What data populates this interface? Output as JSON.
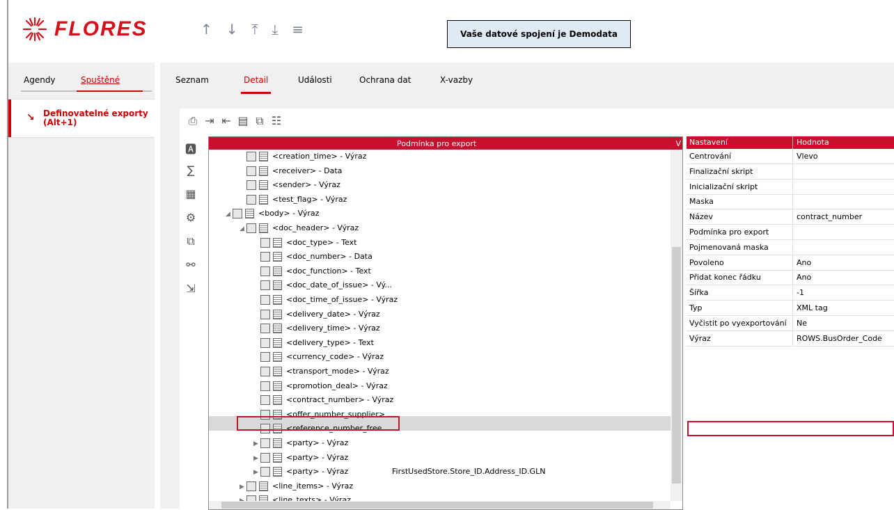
{
  "header": {
    "brand": "FLORES",
    "connection": "Vaše datové spojení je Demodata",
    "arrows": [
      "↑",
      "↓",
      "⤒",
      "⤓",
      "≡"
    ]
  },
  "sidebar": {
    "tabs": [
      "Agendy",
      "Spuštěné"
    ],
    "item": "Definovatelné exporty (Alt+1)"
  },
  "main": {
    "tabs": [
      "Seznam",
      "Detail",
      "Události",
      "Ochrana dat",
      "X-vazby"
    ]
  },
  "tree": {
    "header": "Podmínka pro export",
    "header_right": "V",
    "nodes": [
      {
        "indent": 2,
        "text": "<creation_time> - Výraz",
        "icon": "grid"
      },
      {
        "indent": 2,
        "text": "<receiver> - Data",
        "icon": "lines"
      },
      {
        "indent": 2,
        "text": "<sender> - Výraz",
        "icon": "grid"
      },
      {
        "indent": 2,
        "text": "<test_flag> - Výraz",
        "icon": "grid"
      },
      {
        "indent": 1,
        "text": "<body> - Výraz",
        "icon": "grid",
        "exp": "◢"
      },
      {
        "indent": 2,
        "text": "<doc_header> - Výraz",
        "icon": "grid",
        "exp": "◢"
      },
      {
        "indent": 3,
        "text": "<doc_type> - Text",
        "icon": "text"
      },
      {
        "indent": 3,
        "text": "<doc_number> - Data",
        "icon": "lines"
      },
      {
        "indent": 3,
        "text": "<doc_function> - Text",
        "icon": "text"
      },
      {
        "indent": 3,
        "text": "<doc_date_of_issue> - Vý...",
        "icon": "grid"
      },
      {
        "indent": 3,
        "text": "<doc_time_of_issue> - Výraz",
        "icon": "grid"
      },
      {
        "indent": 3,
        "text": "<delivery_date> - Výraz",
        "icon": "grid"
      },
      {
        "indent": 3,
        "text": "<delivery_time> - Výraz",
        "icon": "grid"
      },
      {
        "indent": 3,
        "text": "<delivery_type> - Text",
        "icon": "text"
      },
      {
        "indent": 3,
        "text": "<currency_code> - Výraz",
        "icon": "grid"
      },
      {
        "indent": 3,
        "text": "<transport_mode> - Výraz",
        "icon": "grid"
      },
      {
        "indent": 3,
        "text": "<promotion_deal> - Výraz",
        "icon": "grid"
      },
      {
        "indent": 3,
        "text": "<contract_number> - Výraz",
        "icon": "grid",
        "selected": true
      },
      {
        "indent": 3,
        "text": "<offer_number_supplier> ...",
        "icon": "grid"
      },
      {
        "indent": 3,
        "text": "<reference_number_free...",
        "icon": "grid"
      },
      {
        "indent": 3,
        "text": "<party> - Výraz",
        "icon": "grid",
        "exp": "▶"
      },
      {
        "indent": 3,
        "text": "<party> - Výraz",
        "icon": "grid",
        "exp": "▶"
      },
      {
        "indent": 3,
        "text": "<party> - Výraz",
        "icon": "grid",
        "exp": "▶",
        "expr": "FirstUsedStore.Store_ID.Address_ID.GLN"
      },
      {
        "indent": 2,
        "text": "<line_items> - Výraz",
        "icon": "grid",
        "exp": "▶"
      },
      {
        "indent": 2,
        "text": "<line_texts> - Výraz",
        "icon": "grid",
        "exp": "▶"
      }
    ]
  },
  "props": {
    "head_key": "Nastavení",
    "head_val": "Hodnota",
    "rows": [
      {
        "k": "Centrování",
        "v": "Vlevo"
      },
      {
        "k": "Finalizační skript",
        "v": ""
      },
      {
        "k": "Inicializační skript",
        "v": ""
      },
      {
        "k": "Maska",
        "v": ""
      },
      {
        "k": "Název",
        "v": "contract_number"
      },
      {
        "k": "Podmínka pro export",
        "v": ""
      },
      {
        "k": "Pojmenovaná maska",
        "v": ""
      },
      {
        "k": "Povoleno",
        "v": "Ano"
      },
      {
        "k": "Přidat konec řádku",
        "v": "Ano"
      },
      {
        "k": "Šířka",
        "v": "-1"
      },
      {
        "k": "Typ",
        "v": "XML tag"
      },
      {
        "k": "Vyčistit po vyexportování",
        "v": "Ne"
      },
      {
        "k": "Výraz",
        "v": "ROWS.BusOrder_Code"
      }
    ]
  }
}
